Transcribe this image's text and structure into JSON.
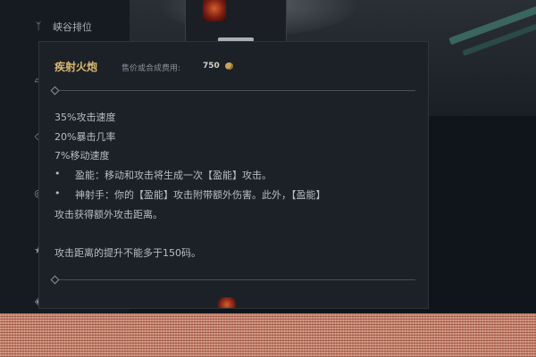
{
  "sidebar": {
    "items": [
      {
        "icon": "crown-wings-icon",
        "glyph": "ᛉ",
        "label": "峡谷排位"
      },
      {
        "icon": "box-icon",
        "glyph": "▱",
        "label": ""
      },
      {
        "icon": "shield-icon",
        "glyph": "◇",
        "label": ""
      },
      {
        "icon": "fist-icon",
        "glyph": "◎",
        "label": ""
      },
      {
        "icon": "star-icon",
        "glyph": "★",
        "label": ""
      },
      {
        "icon": "gem-icon",
        "glyph": "◈",
        "label": ""
      }
    ]
  },
  "tooltip": {
    "title": "疾射火炮",
    "cost_label": "售价或合成费用:",
    "cost_value": "750",
    "stats": [
      "35%攻击速度",
      "20%暴击几率",
      "7%移动速度"
    ],
    "bullets": [
      {
        "symbol": "•",
        "text": "盈能：移动和攻击将生成一次【盈能】攻击。"
      },
      {
        "symbol": "•",
        "text": "神射手：你的【盈能】攻击附带额外伤害。此外，【盈能】"
      }
    ],
    "bullet_continuation": "攻击获得额外攻击距离。",
    "note": "攻击距离的提升不能多于150码。"
  },
  "colors": {
    "title_gold": "#d9b871",
    "body_text": "#b8bec6",
    "tooltip_bg": "#1c2027",
    "coin": "#c9a55a"
  }
}
